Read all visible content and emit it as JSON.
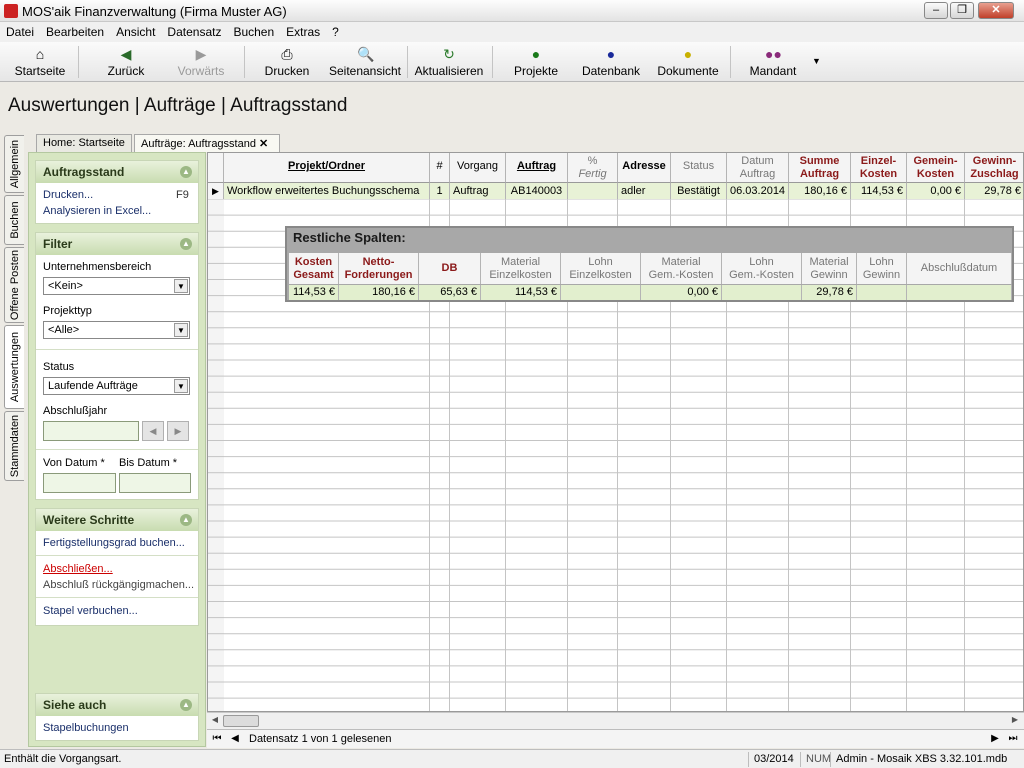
{
  "window": {
    "title": "MOS'aik Finanzverwaltung (Firma Muster AG)"
  },
  "menu": [
    "Datei",
    "Bearbeiten",
    "Ansicht",
    "Datensatz",
    "Buchen",
    "Extras",
    "?"
  ],
  "toolbar": {
    "startseite": "Startseite",
    "zurueck": "Zurück",
    "vorwaerts": "Vorwärts",
    "drucken": "Drucken",
    "seitenansicht": "Seitenansicht",
    "aktualisieren": "Aktualisieren",
    "projekte": "Projekte",
    "datenbank": "Datenbank",
    "dokumente": "Dokumente",
    "mandant": "Mandant"
  },
  "page_title": "Auswertungen | Aufträge | Auftragsstand",
  "vtabs": [
    "Allgemein",
    "Buchen",
    "Offene Posten",
    "Auswertungen",
    "Stammdaten"
  ],
  "tabs": {
    "home": "Home: Startseite",
    "current": "Aufträge: Auftragsstand"
  },
  "sidebar": {
    "auftragsstand": {
      "title": "Auftragsstand",
      "drucken": "Drucken...",
      "drucken_key": "F9",
      "excel": "Analysieren in Excel..."
    },
    "filter": {
      "title": "Filter",
      "unternehmensbereich_label": "Unternehmensbereich",
      "unternehmensbereich_value": "<Kein>",
      "projekttyp_label": "Projekttyp",
      "projekttyp_value": "<Alle>",
      "status_label": "Status",
      "status_value": "Laufende Aufträge",
      "abschlussjahr_label": "Abschlußjahr",
      "von_datum_label": "Von Datum *",
      "bis_datum_label": "Bis Datum *"
    },
    "weitere": {
      "title": "Weitere Schritte",
      "fertig": "Fertigstellungsgrad buchen...",
      "abschliessen": "Abschließen...",
      "rueckgaengig": "Abschluß rückgängigmachen...",
      "stapel": "Stapel verbuchen..."
    },
    "siehe": {
      "title": "Siehe auch",
      "stapelbuchungen": "Stapelbuchungen"
    }
  },
  "grid": {
    "headers": {
      "projekt": "Projekt/Ordner",
      "nr": "#",
      "vorgang": "Vorgang",
      "auftrag": "Auftrag",
      "fertig1": "%",
      "fertig2": "Fertig",
      "adresse": "Adresse",
      "status": "Status",
      "datum1": "Datum",
      "datum2": "Auftrag",
      "summe1": "Summe",
      "summe2": "Auftrag",
      "einzel1": "Einzel-",
      "einzel2": "Kosten",
      "gemein1": "Gemein-",
      "gemein2": "Kosten",
      "gewinn1": "Gewinn-",
      "gewinn2": "Zuschlag"
    },
    "row": {
      "projekt": "Workflow erweitertes Buchungsschema",
      "nr": "1",
      "vorgang": "Auftrag",
      "auftrag": "AB140003",
      "fertig": "",
      "adresse": "adler",
      "status": "Bestätigt",
      "datum": "06.03.2014",
      "summe": "180,16 €",
      "einzel": "114,53 €",
      "gemein": "0,00 €",
      "gewinn": "29,78 €"
    }
  },
  "restliche": {
    "title": "Restliche Spalten:",
    "headers": {
      "kosten1": "Kosten",
      "kosten2": "Gesamt",
      "netto1": "Netto-",
      "netto2": "Forderungen",
      "db": "DB",
      "matek1": "Material",
      "matek2": "Einzelkosten",
      "lohnek1": "Lohn",
      "lohnek2": "Einzelkosten",
      "matgk1": "Material",
      "matgk2": "Gem.-Kosten",
      "lohngk1": "Lohn",
      "lohngk2": "Gem.-Kosten",
      "matg1": "Material",
      "matg2": "Gewinn",
      "lohng1": "Lohn",
      "lohng2": "Gewinn",
      "abschluss": "Abschlußdatum"
    },
    "row": {
      "kosten": "114,53 €",
      "netto": "180,16 €",
      "db": "65,63 €",
      "matek": "114,53 €",
      "lohnek": "",
      "matgk": "0,00 €",
      "lohngk": "",
      "matg": "29,78 €",
      "lohng": "",
      "abschluss": ""
    }
  },
  "navbar": {
    "text": "Datensatz 1 von 1 gelesenen"
  },
  "statusbar": {
    "message": "Enthält die Vorgangsart.",
    "period": "03/2014",
    "num": "NUM",
    "user": "Admin - Mosaik XBS 3.32.101.mdb"
  }
}
